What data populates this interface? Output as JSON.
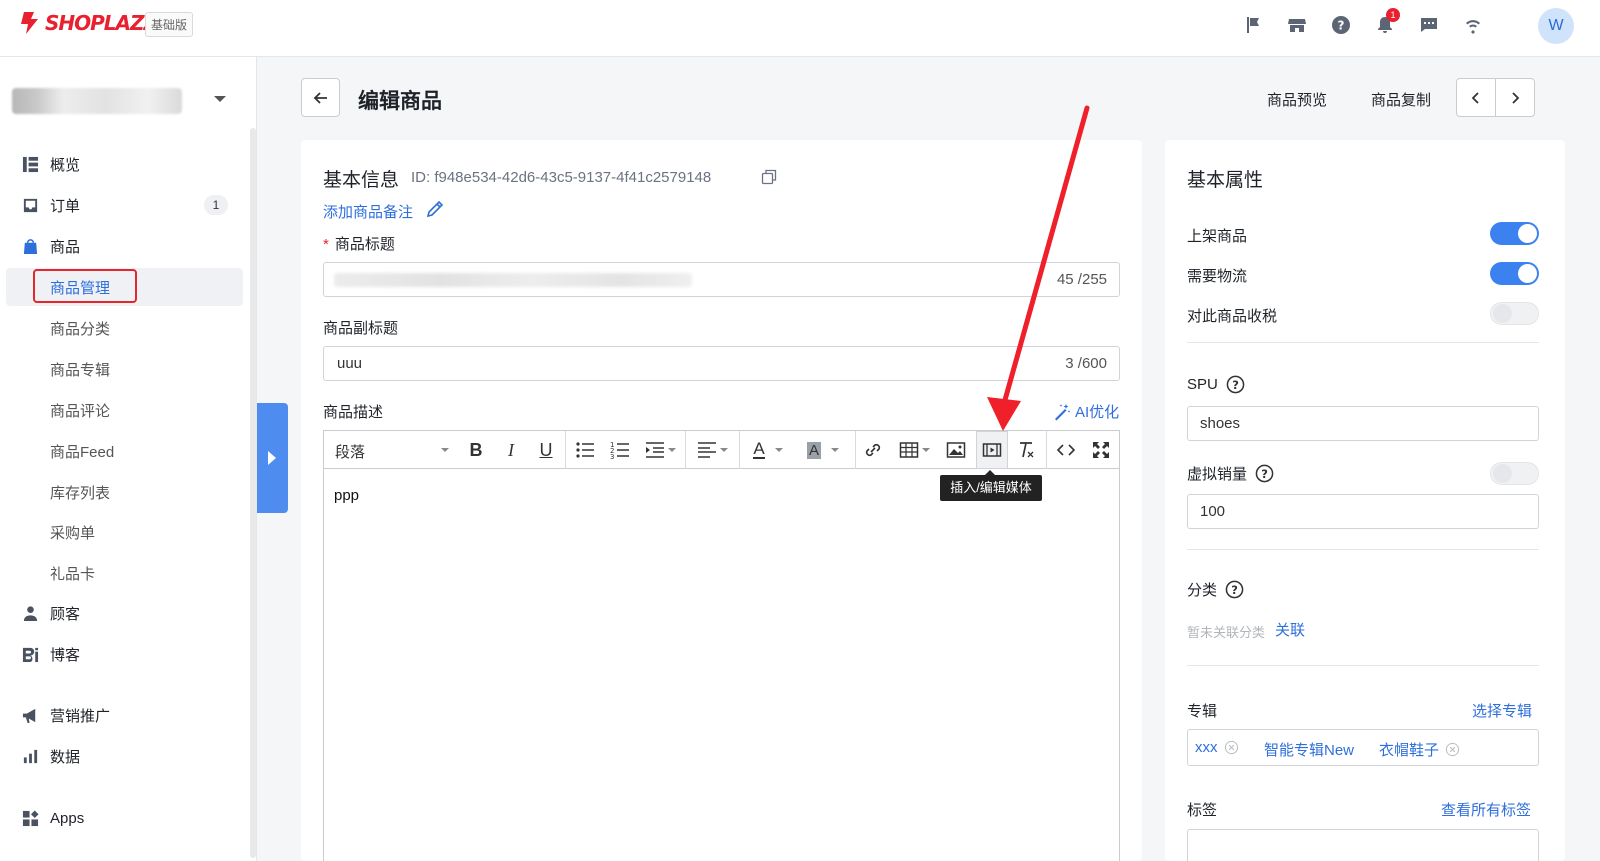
{
  "topbar": {
    "logo_text": "SHOPLAZZA",
    "plan_badge": "基础版",
    "notification_count": "1",
    "avatar_initial": "W",
    "icons": [
      "flag-icon",
      "store-icon",
      "help-icon",
      "bell-icon",
      "chat-icon",
      "wifi-icon"
    ]
  },
  "sidebar": {
    "nav": [
      {
        "label": "概览",
        "icon": "dashboard-icon"
      },
      {
        "label": "订单",
        "icon": "inbox-icon",
        "badge": "1"
      },
      {
        "label": "商品",
        "icon": "bag-icon"
      }
    ],
    "product_sub": [
      "商品管理",
      "商品分类",
      "商品专辑",
      "商品评论",
      "商品Feed",
      "库存列表",
      "采购单",
      "礼品卡"
    ],
    "nav2": [
      {
        "label": "顾客",
        "icon": "person-icon"
      },
      {
        "label": "博客",
        "icon": "blog-icon"
      },
      {
        "label": "营销推广",
        "icon": "megaphone-icon"
      },
      {
        "label": "数据",
        "icon": "bar-chart-icon"
      },
      {
        "label": "Apps",
        "icon": "apps-icon"
      }
    ]
  },
  "header": {
    "title": "编辑商品",
    "preview_label": "商品预览",
    "duplicate_label": "商品复制"
  },
  "basic": {
    "title": "基本信息",
    "id_text": "ID: f948e534-42d6-43c5-9137-4f41c2579148",
    "add_note": "添加商品备注",
    "title_label": "商品标题",
    "required_mark": "*",
    "title_count": "45 /255",
    "subtitle_label": "商品副标题",
    "subtitle_value": "uuu",
    "subtitle_count": "3 /600",
    "desc_label": "商品描述",
    "ai_label": "AI优化"
  },
  "editor": {
    "format_select": "段落",
    "body_text": "ppp",
    "tooltip": "插入/编辑媒体",
    "bold": "B",
    "italic": "I",
    "underline": "U",
    "font_color": "A",
    "bg_color": "A"
  },
  "attributes": {
    "title": "基本属性",
    "publish_label": "上架商品",
    "publish_on": true,
    "shipping_label": "需要物流",
    "shipping_on": true,
    "tax_label": "对此商品收税",
    "tax_on": false,
    "spu_label": "SPU",
    "spu_value": "shoes",
    "virtual_sales_label": "虚拟销量",
    "virtual_sales_on": false,
    "virtual_sales_value": "100",
    "category_label": "分类",
    "category_hint": "暂未关联分类",
    "category_link": "关联",
    "collection_label": "专辑",
    "collection_link": "选择专辑",
    "collections": [
      "xxx",
      "智能专辑New",
      "衣帽鞋子"
    ],
    "tags_label": "标签",
    "tags_link": "查看所有标签"
  },
  "colors": {
    "brand_red": "#e8202f",
    "link_blue": "#2f6fdc",
    "toggle_blue": "#3b82f0",
    "annotation_red": "#f0202a"
  }
}
